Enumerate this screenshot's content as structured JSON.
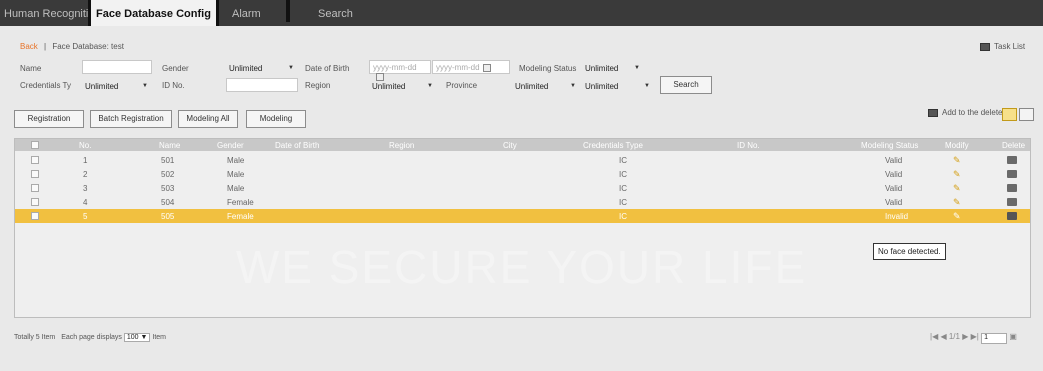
{
  "tabs": [
    {
      "label": "Human Recognition",
      "active": false
    },
    {
      "label": "Face Database Config",
      "active": true
    },
    {
      "label": "Alarm",
      "active": false
    },
    {
      "label": "Search",
      "active": false
    }
  ],
  "breadcrumb": {
    "back": "Back",
    "sep": "|",
    "path": "Face Database: test"
  },
  "task_list": "Task List",
  "filters": {
    "name_label": "Name",
    "name_value": "",
    "gender_label": "Gender",
    "gender_value": "Unlimited",
    "dob_label": "Date of Birth",
    "dob_from_placeholder": "yyyy-mm-dd",
    "dob_to_placeholder": "yyyy-mm-dd",
    "modeling_status_label": "Modeling Status",
    "modeling_status_value": "Unlimited",
    "credentials_label": "Credentials Ty",
    "credentials_value": "Unlimited",
    "id_label": "ID No.",
    "id_value": "",
    "region_label": "Region",
    "region_value": "Unlimited",
    "province_label": "Province",
    "province_value": "Unlimited",
    "city_value": "Unlimited",
    "search_label": "Search"
  },
  "actions": {
    "registration": "Registration",
    "batch_registration": "Batch Registration",
    "modeling_all": "Modeling All",
    "modeling": "Modeling",
    "add_to_delete": "Add to the delete list"
  },
  "table": {
    "headers": [
      "No.",
      "Name",
      "Gender",
      "Date of Birth",
      "Region",
      "City",
      "Credentials Type",
      "ID No.",
      "Modeling Status",
      "Modify",
      "Delete"
    ],
    "rows": [
      {
        "no": "1",
        "name": "501",
        "gender": "Male",
        "cred": "IC",
        "status": "Valid",
        "highlight": false
      },
      {
        "no": "2",
        "name": "502",
        "gender": "Male",
        "cred": "IC",
        "status": "Valid",
        "highlight": false
      },
      {
        "no": "3",
        "name": "503",
        "gender": "Male",
        "cred": "IC",
        "status": "Valid",
        "highlight": false
      },
      {
        "no": "4",
        "name": "504",
        "gender": "Female",
        "cred": "IC",
        "status": "Valid",
        "highlight": false
      },
      {
        "no": "5",
        "name": "505",
        "gender": "Female",
        "cred": "IC",
        "status": "Invalid",
        "highlight": true
      }
    ]
  },
  "tooltip": "No face detected.",
  "footer": {
    "total": "Totally 5 Item",
    "each_page": "Each page displays",
    "page_size": "100",
    "item": "Item",
    "pager_text": "1/1",
    "page_input": "1"
  },
  "watermark": "WE SECURE YOUR LIFE",
  "colors": {
    "highlight": "#f1c040",
    "back_link": "#e8742a",
    "tab_bar": "#3a3a3a"
  }
}
